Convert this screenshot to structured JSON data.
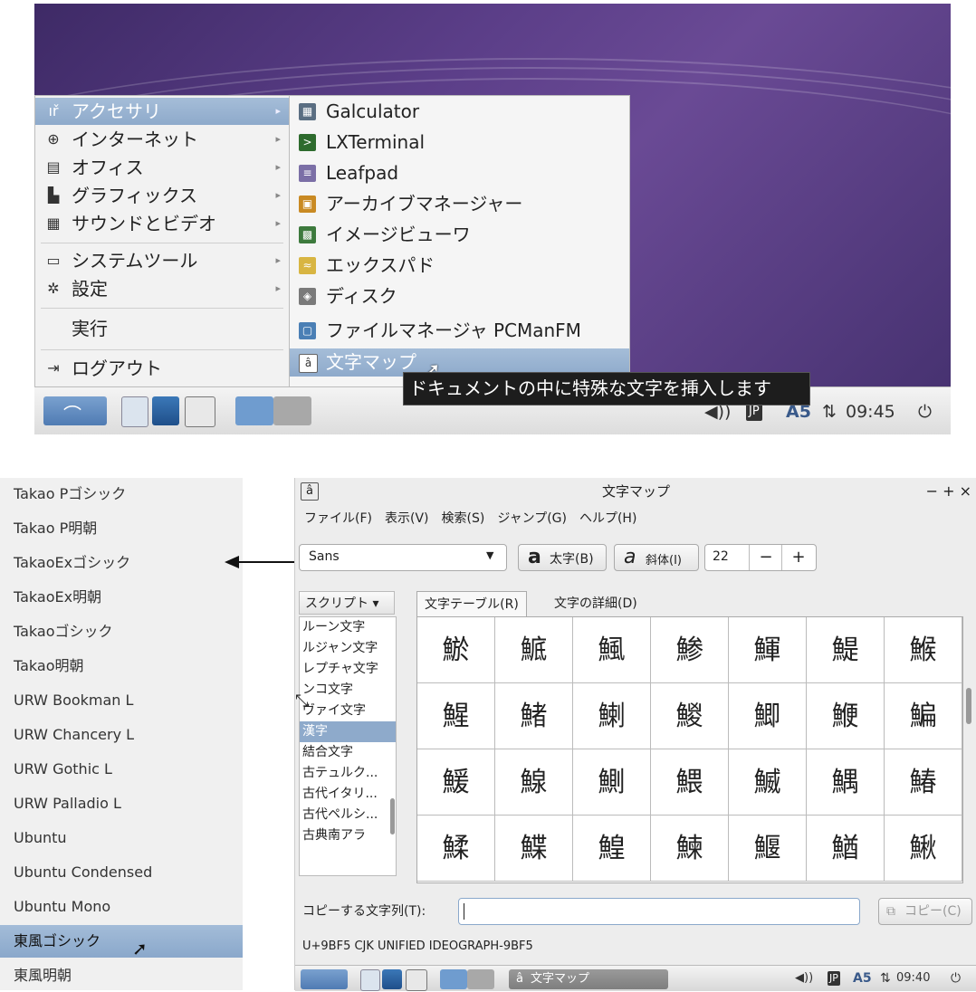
{
  "top": {
    "app_menu": {
      "items": [
        {
          "label": "アクセサリ",
          "icon": "accessories-icon",
          "glyph": "ıř",
          "has_submenu": true,
          "selected": true
        },
        {
          "label": "インターネット",
          "icon": "globe-icon",
          "glyph": "⊕",
          "has_submenu": true
        },
        {
          "label": "オフィス",
          "icon": "document-icon",
          "glyph": "▤",
          "has_submenu": true
        },
        {
          "label": "グラフィックス",
          "icon": "graphics-icon",
          "glyph": "ı̲",
          "has_submenu": true
        },
        {
          "label": "サウンドとビデオ",
          "icon": "media-icon",
          "glyph": "▦",
          "has_submenu": true
        },
        {
          "label": "システムツール",
          "icon": "monitor-icon",
          "glyph": "▭",
          "has_submenu": true
        },
        {
          "label": "設定",
          "icon": "gear-icon",
          "glyph": "✲",
          "has_submenu": true
        },
        {
          "label": "実行",
          "icon": "",
          "glyph": "",
          "has_submenu": false
        },
        {
          "label": "ログアウト",
          "icon": "logout-icon",
          "glyph": "⇥",
          "has_submenu": false
        }
      ]
    },
    "submenu": {
      "items": [
        {
          "label": "Galculator",
          "icon": "calculator-icon",
          "color": "#5a6e82",
          "glyph": "▦"
        },
        {
          "label": "LXTerminal",
          "icon": "terminal-icon",
          "color": "#2e6b2e",
          "glyph": ">_"
        },
        {
          "label": "Leafpad",
          "icon": "notepad-icon",
          "color": "#7b6fa6",
          "glyph": "≡"
        },
        {
          "label": "アーカイブマネージャー",
          "icon": "archive-icon",
          "color": "#c98a23",
          "glyph": "▣"
        },
        {
          "label": "イメージビューワ",
          "icon": "image-viewer-icon",
          "color": "#3d7a3d",
          "glyph": "▩"
        },
        {
          "label": "エックスパド",
          "icon": "xpad-icon",
          "color": "#d8b542",
          "glyph": "≈"
        },
        {
          "label": "ディスク",
          "icon": "disk-icon",
          "color": "#7a7a7a",
          "glyph": "◈"
        },
        {
          "label": "ファイルマネージャ PCManFM",
          "icon": "file-manager-icon",
          "color": "#4a7fb5",
          "glyph": "▢"
        },
        {
          "label": "文字マップ",
          "icon": "charmap-icon",
          "color": "#ffffff",
          "glyph": "â",
          "selected": true
        }
      ]
    },
    "tooltip": "ドキュメントの中に特殊な文字を挿入します",
    "tray": {
      "time": "09:45",
      "lang": "JP",
      "input": "A5"
    }
  },
  "fontlist": {
    "items": [
      {
        "label": "Takao Pゴシック"
      },
      {
        "label": "Takao P明朝"
      },
      {
        "label": "TakaoExゴシック"
      },
      {
        "label": "TakaoEx明朝"
      },
      {
        "label": "Takaoゴシック"
      },
      {
        "label": "Takao明朝"
      },
      {
        "label": "URW Bookman L"
      },
      {
        "label": "URW Chancery L"
      },
      {
        "label": "URW Gothic L"
      },
      {
        "label": "URW Palladio L"
      },
      {
        "label": "Ubuntu"
      },
      {
        "label": "Ubuntu Condensed"
      },
      {
        "label": "Ubuntu Mono"
      },
      {
        "label": "東風ゴシック",
        "selected": true
      },
      {
        "label": "東風明朝"
      }
    ]
  },
  "charmap": {
    "title": "文字マップ",
    "window_controls": "− + ×",
    "menu": [
      "ファイル(F)",
      "表示(V)",
      "検索(S)",
      "ジャンプ(G)",
      "ヘルプ(H)"
    ],
    "font_select": "Sans",
    "bold_label": "太字(B)",
    "italic_label": "斜体(I)",
    "size": "22",
    "minus": "−",
    "plus": "+",
    "script_dropdown": "スクリプト ▾",
    "tabs": [
      "文字テーブル(R)",
      "文字の詳細(D)"
    ],
    "scripts": [
      {
        "label": "ルーン文字"
      },
      {
        "label": "ルジャン文字"
      },
      {
        "label": "レプチャ文字"
      },
      {
        "label": "ンコ文字"
      },
      {
        "label": "ヴァイ文字"
      },
      {
        "label": "漢字",
        "selected": true
      },
      {
        "label": "結合文字"
      },
      {
        "label": "古テュルク..."
      },
      {
        "label": "古代イタリ..."
      },
      {
        "label": "古代ペルシ..."
      },
      {
        "label": "古典南アラ"
      }
    ],
    "chars": [
      [
        "鯲",
        "鯳",
        "鯴",
        "鯵",
        "鯶",
        "鯷",
        "鯸"
      ],
      [
        "鯹",
        "鯺",
        "鯻",
        "鯼",
        "鯽",
        "鯾",
        "鯿"
      ],
      [
        "鰀",
        "鰁",
        "鰂",
        "鰃",
        "鰄",
        "鰅",
        "鰆"
      ],
      [
        "鰇",
        "鰈",
        "鰉",
        "鰊",
        "鰋",
        "鰌",
        "鰍"
      ]
    ],
    "copy_label": "コピーする文字列(T):",
    "copy_value": "",
    "copy_button": "コピー(C)",
    "status": "U+9BF5 CJK UNIFIED IDEOGRAPH-9BF5",
    "taskbar_item": "文字マップ",
    "tray": {
      "time": "09:40",
      "lang": "JP",
      "input": "A5"
    }
  }
}
